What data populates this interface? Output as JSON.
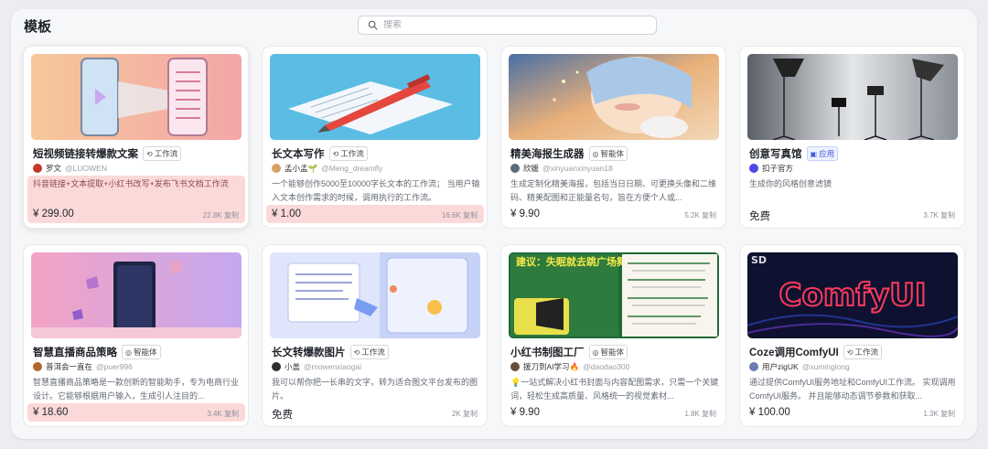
{
  "header": {
    "title": "模板",
    "search_placeholder": "搜索"
  },
  "cards": [
    {
      "name": "短视频链接转爆款文案",
      "tag": "工作流",
      "tag_icon": "workflow-icon",
      "author": "罗文",
      "handle": "@LUOWEN",
      "desc": "抖音链接+文本提取+小红书改写+发布飞书文档工作流",
      "price": "¥ 299.00",
      "stats": "22.8K 复制",
      "highlight": "full"
    },
    {
      "name": "长文本写作",
      "tag": "工作流",
      "tag_icon": "workflow-icon",
      "author": "孟小孟🌱",
      "handle": "@Meng_dreamfly",
      "desc": "一个能够创作5000至10000字长文本的工作流； 当用户输入文本创作需求的时候，调用执行的工作流。",
      "price": "¥ 1.00",
      "stats": "16.6K 复制",
      "highlight": "price"
    },
    {
      "name": "精美海报生成器",
      "tag": "智能体",
      "tag_icon": "agent-icon",
      "author": "欣媛",
      "handle": "@xinyuanxinyuan18",
      "desc": "生成定制化精美海报，包括当日日期、可更换头像和二维码、精美配图和正能量名句，旨在方便个人或...",
      "price": "¥ 9.90",
      "stats": "5.2K 复制",
      "highlight": "none"
    },
    {
      "name": "创意写真馆",
      "tag": "应用",
      "tag_icon": "app-icon",
      "author": "扣子官方",
      "handle": "",
      "desc": "生成你的风格创意滤镜",
      "price": "免费",
      "stats": "3.7K 复制",
      "highlight": "none"
    },
    {
      "name": "智慧直播商品策略",
      "tag": "智能体",
      "tag_icon": "agent-icon",
      "author": "普洱会一直在",
      "handle": "@puer996",
      "desc": "智慧直播商品策略是一款创新的智能助手，专为电商行业设计。它能够根据用户输入，生成引人注目的...",
      "price": "¥ 18.60",
      "stats": "3.4K 复制",
      "highlight": "price"
    },
    {
      "name": "长文转爆款图片",
      "tag": "工作流",
      "tag_icon": "workflow-icon",
      "author": "小盖",
      "handle": "@mowenxiaogai",
      "desc": "我可以帮你把一长串的文字，转为适合图文平台发布的图片。",
      "price": "免费",
      "stats": "2K 复制",
      "highlight": "none"
    },
    {
      "name": "小红书制图工厂",
      "tag": "智能体",
      "tag_icon": "agent-icon",
      "author": "援刀到AI学习🔥",
      "handle": "@daodao300",
      "desc": "💡一站式解决小红书封面与内容配图需求，只需一个关键词，轻松生成高质量、风格统一的视觉素材...",
      "price": "¥ 9.90",
      "stats": "1.8K 复制",
      "highlight": "none"
    },
    {
      "name": "Coze调用ComfyUI",
      "tag": "工作流",
      "tag_icon": "workflow-icon",
      "author": "用户zigUK",
      "handle": "@xuminglong",
      "desc": "通过提供ComfyUI服务地址和ComfyUI工作流。 实现调用ComfyUI服务。 并且能够动态调节参数和获取...",
      "price": "¥ 100.00",
      "stats": "1.3K 复制",
      "highlight": "none"
    }
  ],
  "thumbs": {
    "poster_title": "建议：失眠就去跳广场舞",
    "comfy_text": "ComfyUI",
    "comfy_corner": "SD"
  },
  "colors": {
    "highlight": "#fcd9d9",
    "accent": "#3b5bdb"
  }
}
